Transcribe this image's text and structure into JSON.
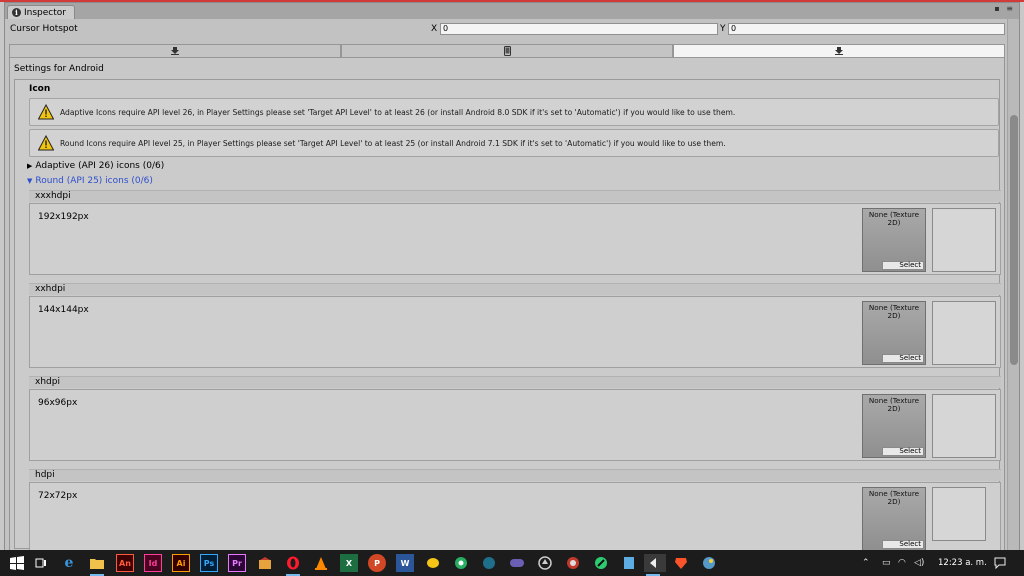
{
  "window": {
    "tab_title": "Inspector",
    "controls": "▪ ≡"
  },
  "hotspot": {
    "label": "Cursor Hotspot",
    "x_label": "X",
    "x_value": "0",
    "y_label": "Y",
    "y_value": "0"
  },
  "platform_tabs": [
    {
      "name": "standalone",
      "icon": "download-arrow-icon",
      "active": false
    },
    {
      "name": "mobile",
      "icon": "phone-icon",
      "active": false
    },
    {
      "name": "android",
      "icon": "download-arrow-icon",
      "active": true
    }
  ],
  "settings": {
    "title": "Settings for Android",
    "section": "Icon",
    "warnings": [
      "Adaptive Icons require API level 26, in Player Settings please set 'Target API Level' to at least 26 (or install Android 8.0 SDK if it's set to 'Automatic') if you would like to use them.",
      "Round Icons require API level 25, in Player Settings please set 'Target API Level' to at least 25 (or install Android 7.1 SDK if it's set to 'Automatic') if you would like to use them."
    ],
    "foldouts": {
      "adaptive": "Adaptive (API 26) icons (0/6)",
      "round": "Round (API 25) icons (0/6)"
    },
    "slot_none": "None (Texture 2D)",
    "slot_select": "Select",
    "resolutions": [
      {
        "name": "xxxhdpi",
        "size": "192x192px"
      },
      {
        "name": "xxhdpi",
        "size": "144x144px"
      },
      {
        "name": "xhdpi",
        "size": "96x96px"
      },
      {
        "name": "hdpi",
        "size": "72x72px"
      }
    ]
  },
  "taskbar": {
    "clock": "12:23 a. m.",
    "apps": [
      {
        "name": "start-icon"
      },
      {
        "name": "task-view-icon"
      },
      {
        "name": "edge-icon"
      },
      {
        "name": "file-explorer-icon"
      },
      {
        "name": "animate-icon",
        "label": "An"
      },
      {
        "name": "indesign-icon",
        "label": "Id"
      },
      {
        "name": "illustrator-icon",
        "label": "Ai"
      },
      {
        "name": "photoshop-icon",
        "label": "Ps"
      },
      {
        "name": "premiere-icon",
        "label": "Pr"
      },
      {
        "name": "app-icon"
      },
      {
        "name": "opera-icon"
      },
      {
        "name": "vlc-icon"
      },
      {
        "name": "excel-icon",
        "label": "X"
      },
      {
        "name": "powerpoint-icon",
        "label": "P"
      },
      {
        "name": "word-icon",
        "label": "W"
      },
      {
        "name": "app-icon-2"
      },
      {
        "name": "app-icon-3"
      },
      {
        "name": "app-icon-4"
      },
      {
        "name": "app-icon-5"
      },
      {
        "name": "unity-icon"
      },
      {
        "name": "app-icon-6"
      },
      {
        "name": "app-icon-7"
      },
      {
        "name": "app-icon-8"
      },
      {
        "name": "unity-editor-icon"
      },
      {
        "name": "brave-icon"
      },
      {
        "name": "app-icon-9"
      }
    ]
  }
}
